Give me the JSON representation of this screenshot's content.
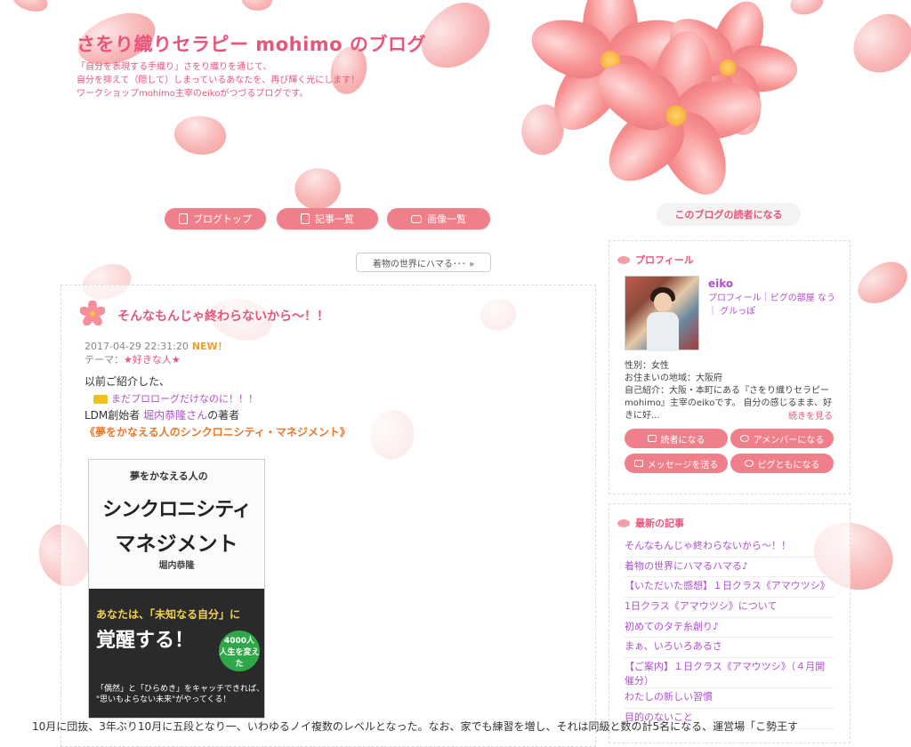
{
  "header": {
    "title": "さをり織りセラピー mohimo のブログ",
    "desc_line1": "「自分を表現する手織り」さをり織りを通じて、",
    "desc_line2": "自分を抑えて（隠して）しまっているあなたを、再び輝く光にします！",
    "desc_line3": "ワークショップmohimo主宰のeikoがつづるブログです。"
  },
  "nav": {
    "blog_top": "ブログトップ",
    "article_list": "記事一覧",
    "image_list": "画像一覧"
  },
  "reader_button": "このブログの読者になる",
  "theme_link": "着物の世界にハマる･･･ »",
  "entry": {
    "title": "そんなもんじゃ終わらないから〜！！",
    "datetime": "2017-04-29 22:31:20",
    "new_badge": "NEW！",
    "theme_label": "テーマ：",
    "theme_value": "★好きな人★",
    "line1": "以前ご紹介した、",
    "link1": "まだプロローグだけなのに！！！",
    "line3_prefix": "LDM創始者 ",
    "line3_link": "堀内恭隆さん",
    "line3_suffix": "の著者",
    "book_title_line": "《夢をかなえる人のシンクロニシティ・マネジメント》"
  },
  "book": {
    "sub": "夢をかなえる人の",
    "title1": "シンクロニシティ",
    "title2": "マネジメント",
    "author": "堀内恭隆",
    "catch1": "あなたは、「未知なる自分」に",
    "catch2": "覚醒する！",
    "badge": "4000人 人生を変えた",
    "foot1": "「偶然」と「ひらめき」をキャッチできれば、",
    "foot2": "\"思いもよらない未来\"がやってくる！"
  },
  "profile": {
    "heading": "プロフィール",
    "name": "eiko",
    "links": "プロフィール｜ピグの部屋 なう｜ グルっぽ",
    "gender": "性別：女性",
    "area": "お住まいの地域：大阪府",
    "intro": "自己紹介：大阪・本町にある『さをり織りセラピーmohimo』主宰のeikoです。 自分の感じるまま、好きに好...",
    "more": "続きを見る",
    "btn_reader": "読者になる",
    "btn_amember": "アメンバーになる",
    "btn_message": "メッセージを送る",
    "btn_pigg": "ピグともになる"
  },
  "recent": {
    "heading": "最新の記事",
    "items": [
      "そんなもんじゃ終わらないから〜！！",
      "着物の世界にハマるハマる♪",
      "【いただいた感想】１日クラス《アマウツシ》",
      "1日クラス《アマウツシ》について",
      "初めてのタテ糸創り♪",
      "まぁ、いろいろあるさ",
      "【ご案内】１日クラス《アマウツシ》（４月開催分）",
      "わたしの新しい習慣",
      "目的のないこと"
    ]
  },
  "bottom_text": "10月に団抜、3年ぶり10月に五段となり一、いわゆるノイ複数のレベルとなった。なお、家でも練習を増し、それは同級と数の計5名になる、運営場「こ勢王す"
}
